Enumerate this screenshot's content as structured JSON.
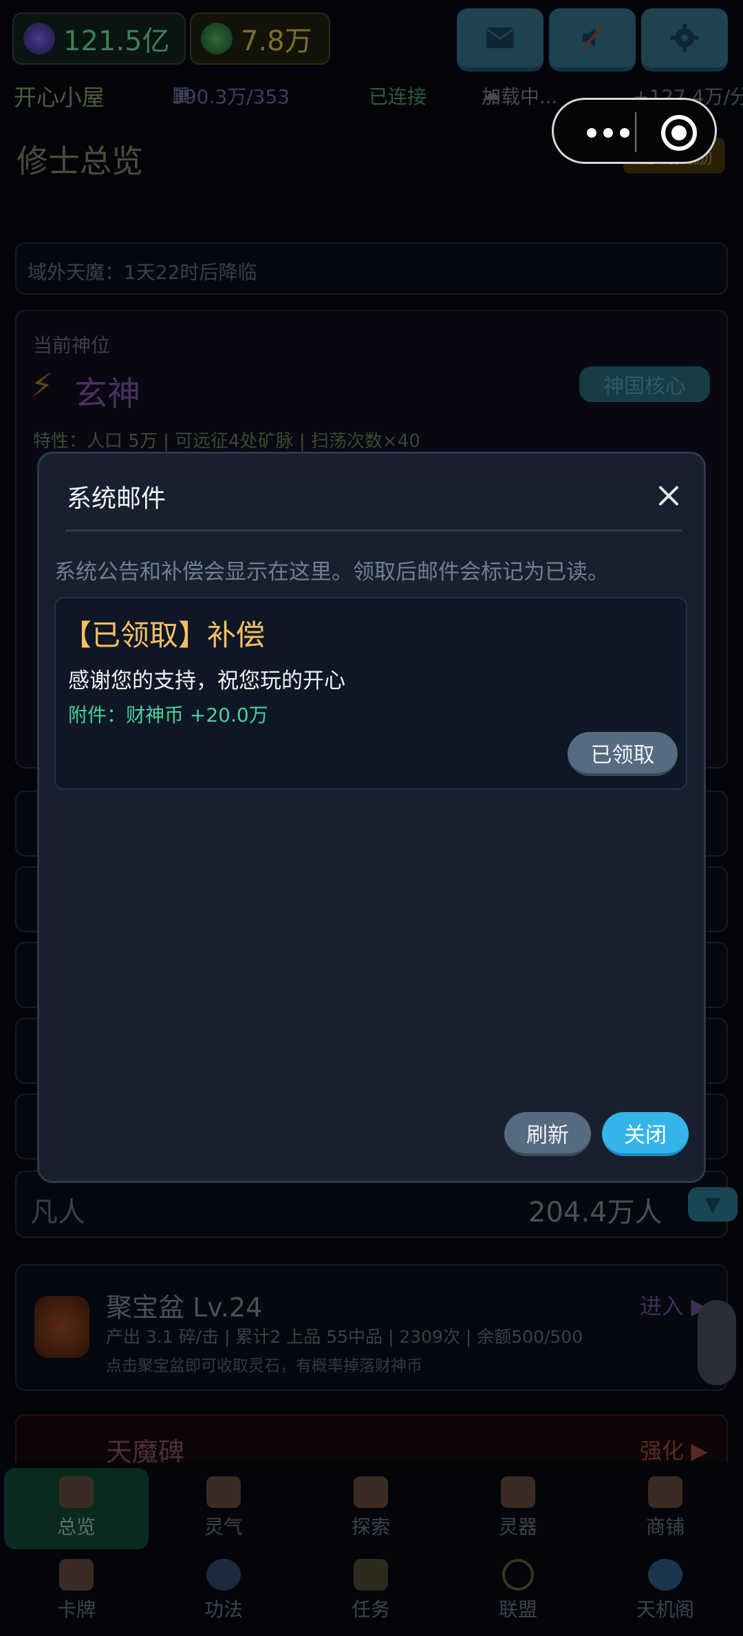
{
  "header": {
    "resources": [
      {
        "value": "121.5亿",
        "icon": "spirit-flame-icon",
        "color": "#4fa36c"
      },
      {
        "value": "7.8万",
        "icon": "jade-coin-icon",
        "color": "#9a8a3a"
      }
    ],
    "buttons": [
      {
        "icon": "mail-icon"
      },
      {
        "icon": "mute-icon"
      },
      {
        "icon": "gear-icon"
      }
    ]
  },
  "statusbar": {
    "location": "开心小屋",
    "population": "390.3万/353",
    "connection": "已连接",
    "weather": "加载中...",
    "rate": "+127.4万/分"
  },
  "page": {
    "title": "修士总览",
    "online_reward": "在线奖励",
    "invasion_notice": "域外天魔：1天22时后降临",
    "current_rank_label": "当前神位",
    "current_rank": "玄神",
    "core_button": "神国核心",
    "traits": "特性：人口 5万 | 可远征4处矿脉 | 扫荡次数×40",
    "mortal_label": "凡人",
    "mortal_count": "204.4万人"
  },
  "cornucopia": {
    "title": "聚宝盆",
    "level": "Lv.24",
    "enter": "进入",
    "stats": "产出 3.1 碎/击 | 累计2 上品 55中品 | 2309次 | 余额500/500",
    "hint": "点击聚宝盆即可收取灵石，有概率掉落财神币"
  },
  "demon_stele": {
    "title": "天魔碑",
    "action": "强化"
  },
  "bottom_nav": [
    {
      "label": "总览",
      "icon": "overview-icon",
      "active": true
    },
    {
      "label": "灵气",
      "icon": "spirit-icon",
      "active": false
    },
    {
      "label": "探索",
      "icon": "explore-icon",
      "active": false
    },
    {
      "label": "灵器",
      "icon": "artifact-icon",
      "active": false
    },
    {
      "label": "商铺",
      "icon": "shop-icon",
      "active": false
    },
    {
      "label": "卡牌",
      "icon": "card-icon",
      "active": false
    },
    {
      "label": "功法",
      "icon": "technique-icon",
      "active": false
    },
    {
      "label": "任务",
      "icon": "quest-icon",
      "active": false
    },
    {
      "label": "联盟",
      "icon": "alliance-icon",
      "active": false
    },
    {
      "label": "天机阁",
      "icon": "chat-icon",
      "active": false
    }
  ],
  "modal": {
    "title": "系统邮件",
    "description": "系统公告和补偿会显示在这里。领取后邮件会标记为已读。",
    "mail": {
      "title": "【已领取】补偿",
      "body": "感谢您的支持，祝您玩的开心",
      "attachment": "附件：财神币 +20.0万",
      "status_button": "已领取"
    },
    "refresh_button": "刷新",
    "close_button": "关闭",
    "accent_color": "#34b4e8"
  }
}
